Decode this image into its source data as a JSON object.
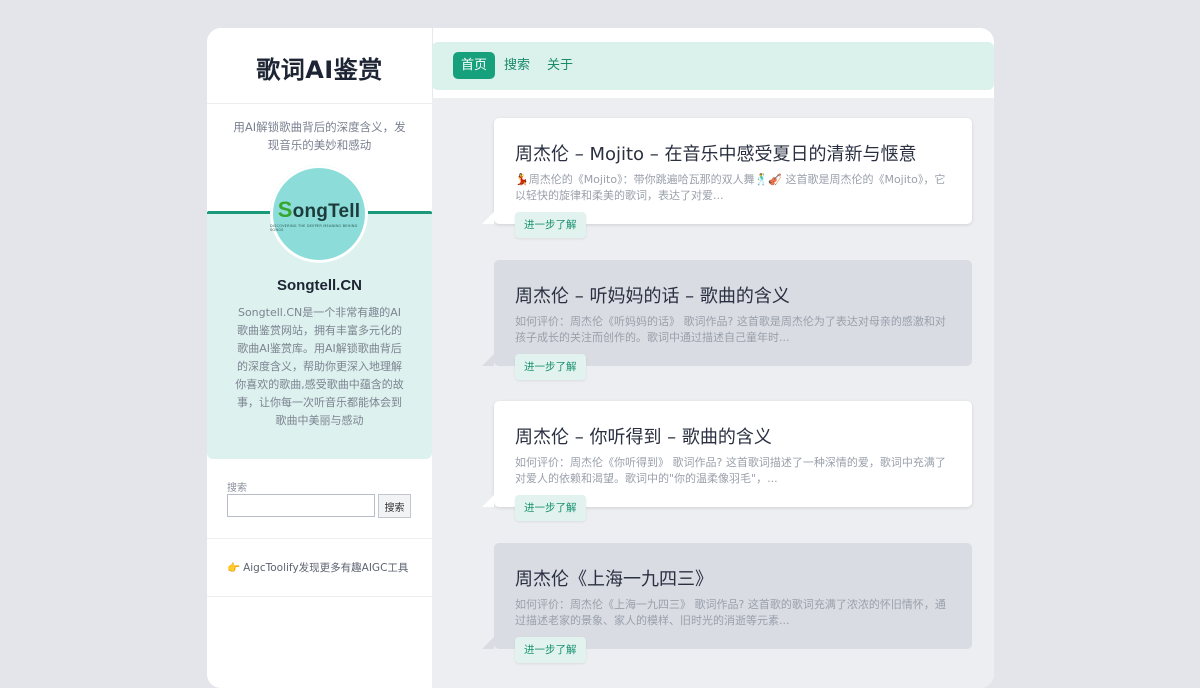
{
  "site": {
    "title": "歌词AI鉴赏",
    "tagline": "用AI解锁歌曲背后的深度含义，发现音乐的美妙和感动"
  },
  "profile": {
    "logo_text_s": "S",
    "logo_text_rest": "ongTell",
    "logo_sub": "DISCOVERING THE DEEPER MEANING BEHIND SONGS",
    "name": "Songtell.CN",
    "description": "Songtell.CN是一个非常有趣的AI歌曲鉴赏网站，拥有丰富多元化的歌曲AI鉴赏库。用AI解锁歌曲背后的深度含义，帮助你更深入地理解你喜欢的歌曲,感受歌曲中蕴含的故事，让你每一次听音乐都能体会到歌曲中美丽与感动"
  },
  "search": {
    "label": "搜索",
    "value": "",
    "button": "搜索"
  },
  "aigc": {
    "icon": "👉",
    "label": "AigcToolify发现更多有趣AIGC工具"
  },
  "nav": {
    "items": [
      {
        "label": "首页",
        "active": true
      },
      {
        "label": "搜索",
        "active": false
      },
      {
        "label": "关于",
        "active": false
      }
    ]
  },
  "posts": [
    {
      "title": "周杰伦 – Mojito – 在音乐中感受夏日的清新与惬意",
      "excerpt": "💃周杰伦的《Mojito》：带你跳遍哈瓦那的双人舞🕺🎻 这首歌是周杰伦的《Mojito》，它以轻快的旋律和柔美的歌词，表达了对爱...",
      "more": "进一步了解"
    },
    {
      "title": "周杰伦 – 听妈妈的话 – 歌曲的含义",
      "excerpt": "如何评价：周杰伦《听妈妈的话》 歌词作品? 这首歌是周杰伦为了表达对母亲的感激和对孩子成长的关注而创作的。歌词中通过描述自己童年时...",
      "more": "进一步了解"
    },
    {
      "title": "周杰伦 – 你听得到 – 歌曲的含义",
      "excerpt": "如何评价：周杰伦《你听得到》 歌词作品? 这首歌词描述了一种深情的爱，歌词中充满了对爱人的依赖和渴望。歌词中的\"你的温柔像羽毛\"，...",
      "more": "进一步了解"
    },
    {
      "title": "周杰伦《上海一九四三》",
      "excerpt": "如何评价：周杰伦《上海一九四三》 歌词作品? 这首歌的歌词充满了浓浓的怀旧情怀，通过描述老家的景象、家人的模样、旧时光的消逝等元素...",
      "more": "进一步了解"
    }
  ],
  "colors": {
    "accent": "#17a07c",
    "nav_bg": "#dbf1ec",
    "card_bg": "#ddf1ee",
    "page_bg": "#e3e5ea"
  }
}
